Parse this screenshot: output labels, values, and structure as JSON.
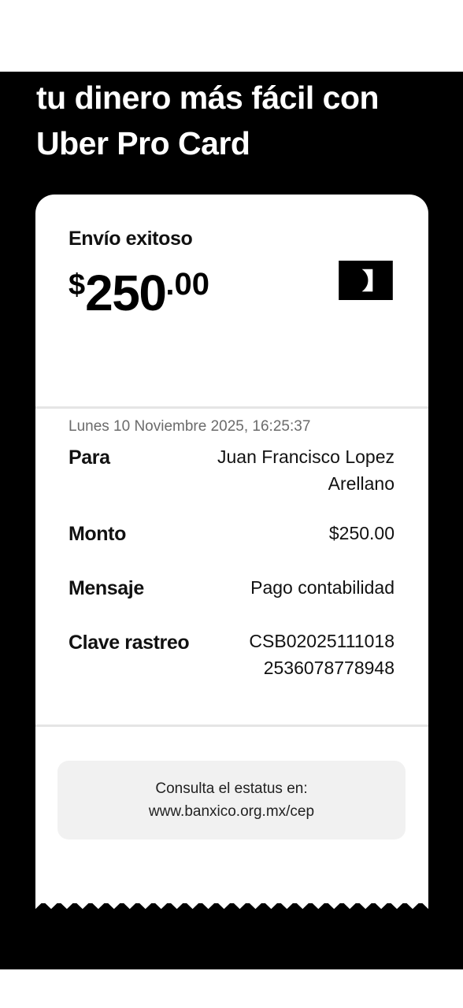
{
  "headline": {
    "line1": "tu dinero más fácil con",
    "line2": "Uber Pro Card"
  },
  "receipt": {
    "status": "Envío exitoso",
    "amount": {
      "currency": "$",
      "integer": "250",
      "decimal": ".00"
    },
    "logo_icon": "brand-logo-icon",
    "datetime": "Lunes 10 Noviembre 2025, 16:25:37",
    "details": {
      "para_label": "Para",
      "para_value_line1": "Juan Francisco Lopez",
      "para_value_line2": "Arellano",
      "monto_label": "Monto",
      "monto_value": "$250.00",
      "mensaje_label": "Mensaje",
      "mensaje_value": "Pago contabilidad",
      "clave_label": "Clave rastreo",
      "clave_value_line1": "CSB02025111018",
      "clave_value_line2": "2536078778948"
    },
    "info": {
      "line1": "Consulta el estatus en:",
      "line2": "www.banxico.org.mx/cep"
    }
  },
  "colors": {
    "background": "#000000",
    "card": "#ffffff",
    "info_box": "#f1f1f1",
    "muted_text": "#6b6b6b"
  }
}
